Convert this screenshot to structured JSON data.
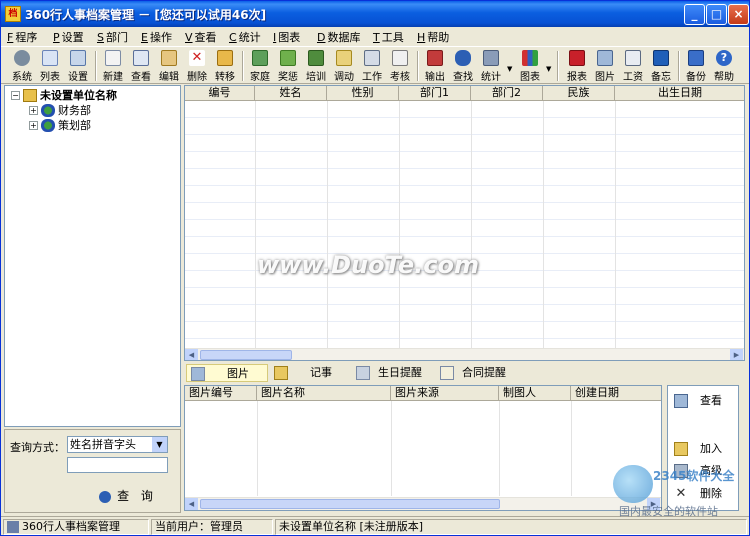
{
  "window": {
    "title": "360行人事档案管理 － [您还可以试用46次]",
    "minimize": "_",
    "maximize": "□",
    "close": "×"
  },
  "menu": [
    {
      "key": "F",
      "label": "程序"
    },
    {
      "key": "P",
      "label": "设置"
    },
    {
      "key": "S",
      "label": "部门"
    },
    {
      "key": "E",
      "label": "操作"
    },
    {
      "key": "V",
      "label": "查看"
    },
    {
      "key": "C",
      "label": "统计"
    },
    {
      "key": "I",
      "label": "图表"
    },
    {
      "key": "D",
      "label": "数据库"
    },
    {
      "key": "T",
      "label": "工具"
    },
    {
      "key": "H",
      "label": "帮助"
    }
  ],
  "toolbar": {
    "system": "系统",
    "list": "列表",
    "settings": "设置",
    "new": "新建",
    "view": "查看",
    "edit": "编辑",
    "delete": "删除",
    "transfer": "转移",
    "family": "家庭",
    "reward": "奖惩",
    "training": "培训",
    "move": "调动",
    "work": "工作",
    "assess": "考核",
    "export": "输出",
    "find": "查找",
    "stats": "统计",
    "chart": "图表",
    "report": "报表",
    "picture": "图片",
    "salary": "工资",
    "memo": "备忘",
    "backup": "备份",
    "help": "帮助"
  },
  "tree": {
    "root": "未设置单位名称",
    "children": [
      "财务部",
      "策划部"
    ]
  },
  "query": {
    "label": "查询方式：",
    "mode": "姓名拼音字头",
    "input_value": "",
    "button": "查 询"
  },
  "grid": {
    "columns": [
      "编号",
      "姓名",
      "性别",
      "部门1",
      "部门2",
      "民族",
      "出生日期"
    ]
  },
  "tabs": [
    "图片",
    "记事",
    "生日提醒",
    "合同提醒"
  ],
  "pictures": {
    "columns": [
      "图片编号",
      "图片名称",
      "图片来源",
      "制图人",
      "创建日期"
    ]
  },
  "picture_actions": [
    "查看",
    "加入",
    "高级",
    "删除"
  ],
  "status": {
    "app": "360行人事档案管理",
    "user": "当前用户：管理员",
    "org": "未设置单位名称  [未注册版本]"
  },
  "watermark": {
    "center": "www.DuoTe.com",
    "brand": "2345软件大全",
    "slogan": "国内最安全的软件站"
  },
  "colors": {
    "titlebar": "#0b5fe0",
    "chrome": "#ece9d8",
    "active_tab": "#fffbd2"
  }
}
